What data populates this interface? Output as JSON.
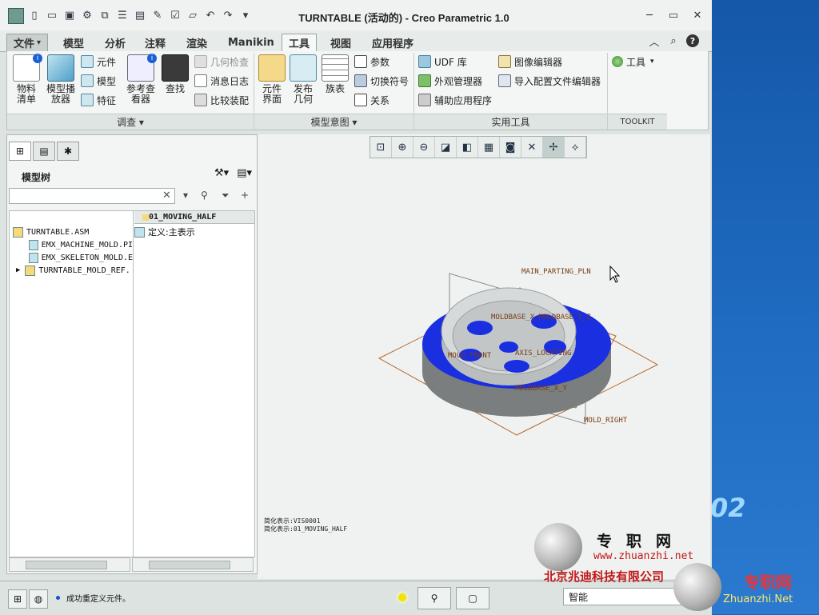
{
  "window": {
    "title": "TURNTABLE (活动的) - Creo Parametric 1.0"
  },
  "tabs": [
    {
      "label": "文件",
      "dropdown": "▾"
    },
    {
      "label": "模型"
    },
    {
      "label": "分析"
    },
    {
      "label": "注释"
    },
    {
      "label": "渲染"
    },
    {
      "label": "Manikin"
    },
    {
      "label": "工具",
      "active": true
    },
    {
      "label": "视图"
    },
    {
      "label": "应用程序"
    }
  ],
  "ribbon": {
    "groups": [
      {
        "label": "调查 ▾"
      },
      {
        "label": "模型意图 ▾"
      },
      {
        "label": "实用工具"
      },
      {
        "label": "TOOLKIT"
      }
    ],
    "big_buttons": {
      "bom": "物料\n清单",
      "model_player": "模型播\n放器",
      "ref_viewer": "参考查\n看器",
      "find": "查找",
      "component_interface": "元件\n界面",
      "publish_geom": "发布\n几何",
      "family_table": "族表"
    },
    "small_buttons": {
      "component": "元件",
      "model": "模型",
      "feature": "特征",
      "geom_check": "几何检查",
      "message_log": "消息日志",
      "compare_assembly": "比较装配",
      "parameters": "参数",
      "switch_symbols": "切换符号",
      "relations": "关系",
      "udf_library": "UDF 库",
      "appearance_manager": "外观管理器",
      "aux_applications": "辅助应用程序",
      "image_editor": "图像编辑器",
      "import_config_editor": "导入配置文件编辑器",
      "tools": "工具"
    }
  },
  "model_tree": {
    "title": "模型树",
    "search_placeholder": "",
    "column_header": "01_MOVING_HALF",
    "items": [
      {
        "label": "TURNTABLE.ASM",
        "value": "定义:主表示"
      },
      {
        "label": "EMX_MACHINE_MOLD.PI"
      },
      {
        "label": "EMX_SKELETON_MOLD.E"
      },
      {
        "label": "TURNTABLE_MOLD_REF."
      }
    ]
  },
  "viewport": {
    "labels": {
      "main_parting": "MAIN_PARTING_PLN",
      "moldbase_z": "MOLDBASE_X_MOLDBASE_Y_Z",
      "mold_front": "MOLD_FRONT",
      "axis_locating": "AXIS_LOCATING",
      "moldbase_xy": "MOLDBASE_X_Y",
      "mold_right": "MOLD_RIGHT"
    },
    "info_line1": "简化表示:VIS0001",
    "info_line2": "简化表示:01_MOVING_HALF"
  },
  "status": {
    "message": "成功重定义元件。",
    "filter": "智能"
  },
  "watermark": {
    "brand": "专职网",
    "url": "www.zhuanzhi.net",
    "company": "北京兆迪科技有限公司",
    "brand2": "专职网",
    "url2": "Zhuanzhi.Net",
    "desktop_number": "02"
  },
  "colors": {
    "accent_blue": "#1a2fe0",
    "model_gray": "#b9bdbd",
    "datum_orange": "#b9662a",
    "desktop": "#1d63b3"
  }
}
